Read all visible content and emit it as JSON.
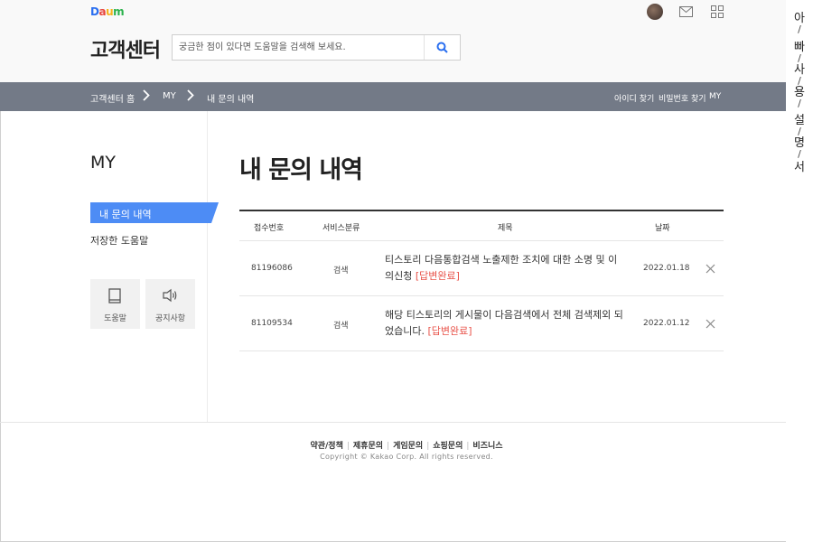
{
  "header": {
    "logo": {
      "letters": [
        "D",
        "a",
        "u",
        "m"
      ],
      "colors": [
        "#2a6ff0",
        "#e8453c",
        "#f6b21a",
        "#2bb24c"
      ]
    },
    "site_title": "고객센터",
    "search": {
      "placeholder": "궁금한 점이 있다면 도움말을 검색해 보세요.",
      "value": "",
      "button_icon": "search-icon"
    },
    "icons": [
      "avatar",
      "mail-icon",
      "apps-icon"
    ]
  },
  "side_text": [
    "아",
    "빠",
    "사",
    "용",
    "설",
    "명",
    "서"
  ],
  "breadcrumb": {
    "items": [
      "고객센터 홈",
      "MY",
      "내 문의 내역"
    ]
  },
  "nav_links": [
    "아이디 찾기",
    "비밀번호 찾기",
    "MY"
  ],
  "sidebar": {
    "title": "MY",
    "items": [
      {
        "label": "내 문의 내역",
        "active": true
      },
      {
        "label": "저장한 도움말",
        "active": false
      }
    ],
    "quick": [
      {
        "label": "도움말",
        "icon": "book-icon"
      },
      {
        "label": "공지사항",
        "icon": "speaker-icon"
      }
    ]
  },
  "main": {
    "title": "내 문의 내역",
    "table": {
      "headers": [
        "접수번호",
        "서비스분류",
        "제목",
        "날짜"
      ],
      "rows": [
        {
          "id": "81196086",
          "category": "검색",
          "title": "티스토리 다음통합검색 노출제한 조치에 대한 소명 및 이의신청",
          "status": "[답변완료]",
          "date": "2022.01.18"
        },
        {
          "id": "81109534",
          "category": "검색",
          "title": "해당 티스토리의 게시물이 다음검색에서 전체 검색제외 되었습니다.",
          "status": "[답변완료]",
          "date": "2022.01.12"
        }
      ]
    }
  },
  "footer": {
    "links": [
      "약관/정책",
      "제휴문의",
      "게임문의",
      "쇼핑문의",
      "비즈니스"
    ],
    "copyright": "Copyright © Kakao Corp. All rights reserved."
  },
  "colors": {
    "navbar": "#737a87",
    "active_item": "#4d8cf5",
    "status": "#e8534a",
    "search_icon": "#2a6ff0"
  }
}
